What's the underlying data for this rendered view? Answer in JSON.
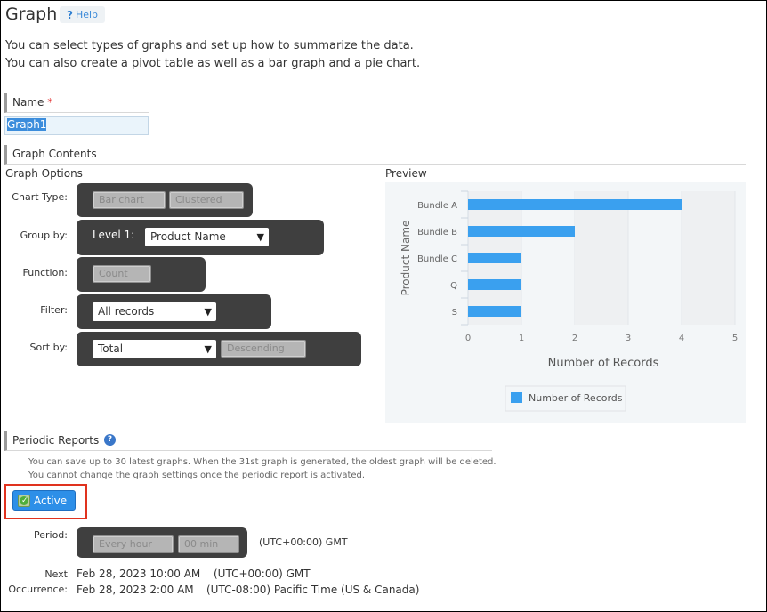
{
  "page": {
    "title": "Graph",
    "help_label": "Help",
    "intro_lines": [
      "You can select types of graphs and set up how to summarize the data.",
      "You can also create a pivot table as well as a bar graph and a pie chart."
    ]
  },
  "name_section": {
    "label": "Name",
    "required_mark": "*",
    "value": "Graph1"
  },
  "graph_contents": {
    "label": "Graph Contents",
    "options_label": "Graph Options",
    "preview_label": "Preview",
    "chart_type": {
      "label": "Chart Type:",
      "type_value": "Bar chart",
      "subtype_value": "Clustered"
    },
    "group_by": {
      "label": "Group by:",
      "level_label": "Level 1:",
      "value": "Product Name"
    },
    "function": {
      "label": "Function:",
      "value": "Count"
    },
    "filter": {
      "label": "Filter:",
      "value": "All records"
    },
    "sort_by": {
      "label": "Sort by:",
      "value": "Total",
      "order_value": "Descending"
    }
  },
  "chart_data": {
    "type": "bar",
    "orientation": "horizontal",
    "categories": [
      "Bundle A",
      "Bundle B",
      "Bundle C",
      "Q",
      "S"
    ],
    "series": [
      {
        "name": "Number of Records",
        "values": [
          4,
          2,
          1,
          1,
          1
        ],
        "color": "#3aa0ef"
      }
    ],
    "xlabel": "Number of Records",
    "ylabel": "Product Name",
    "xlim": [
      0,
      5
    ],
    "xticks": [
      "0",
      "1",
      "2",
      "3",
      "4",
      "5"
    ],
    "grid": "alternating-bands",
    "legend": {
      "entries": [
        "Number of Records"
      ],
      "position": "bottom"
    }
  },
  "periodic_reports": {
    "label": "Periodic Reports",
    "notes": [
      "You can save up to 30 latest graphs. When the 31st graph is generated, the oldest graph will be deleted.",
      "You cannot change the graph settings once the periodic report is activated."
    ],
    "active_label": "Active",
    "period_label": "Period:",
    "period_value": "Every hour",
    "minute_value": "00 min",
    "period_tz": "(UTC+00:00) GMT",
    "next_label": "Next",
    "occurrence_label": "Occurrence:",
    "next_occurrences": [
      {
        "datetime": "Feb 28, 2023 10:00 AM",
        "tz": "(UTC+00:00) GMT"
      },
      {
        "datetime": "Feb 28, 2023 2:00 AM",
        "tz": "(UTC-08:00) Pacific Time (US & Canada)"
      }
    ]
  },
  "colors": {
    "accent": "#2d8fe8",
    "highlight": "#e0321e",
    "bar": "#3aa0ef"
  }
}
